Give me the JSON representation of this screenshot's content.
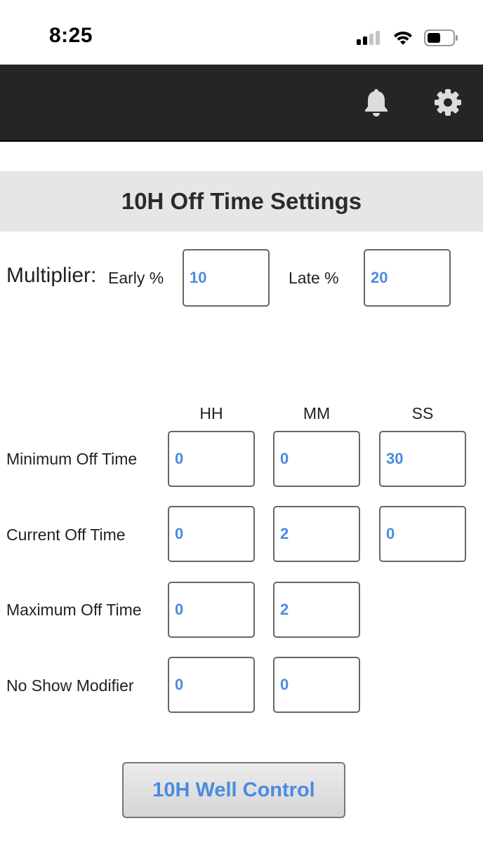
{
  "status_bar": {
    "time": "8:25",
    "icons": [
      "cellular-signal-icon",
      "wifi-icon",
      "battery-icon"
    ]
  },
  "header": {
    "icons": [
      "bell-icon",
      "gear-icon"
    ]
  },
  "page": {
    "title": "10H Off Time Settings"
  },
  "multiplier": {
    "label": "Multiplier:",
    "early_label": "Early %",
    "early_value": "10",
    "late_label": "Late %",
    "late_value": "20"
  },
  "time_grid": {
    "columns": [
      "HH",
      "MM",
      "SS"
    ],
    "rows": [
      {
        "label": "Minimum Off Time",
        "hh": "0",
        "mm": "0",
        "ss": "30"
      },
      {
        "label": "Current Off Time",
        "hh": "0",
        "mm": "2",
        "ss": "0"
      },
      {
        "label": "Maximum Off Time",
        "hh": "0",
        "mm": "2"
      },
      {
        "label": "No Show Modifier",
        "hh": "0",
        "mm": "0"
      }
    ]
  },
  "actions": {
    "well_control_label": "10H Well Control"
  },
  "colors": {
    "header_bg": "#252525",
    "title_band_bg": "#e6e6e6",
    "value_text": "#4a8be0",
    "button_text": "#4a8be0"
  }
}
